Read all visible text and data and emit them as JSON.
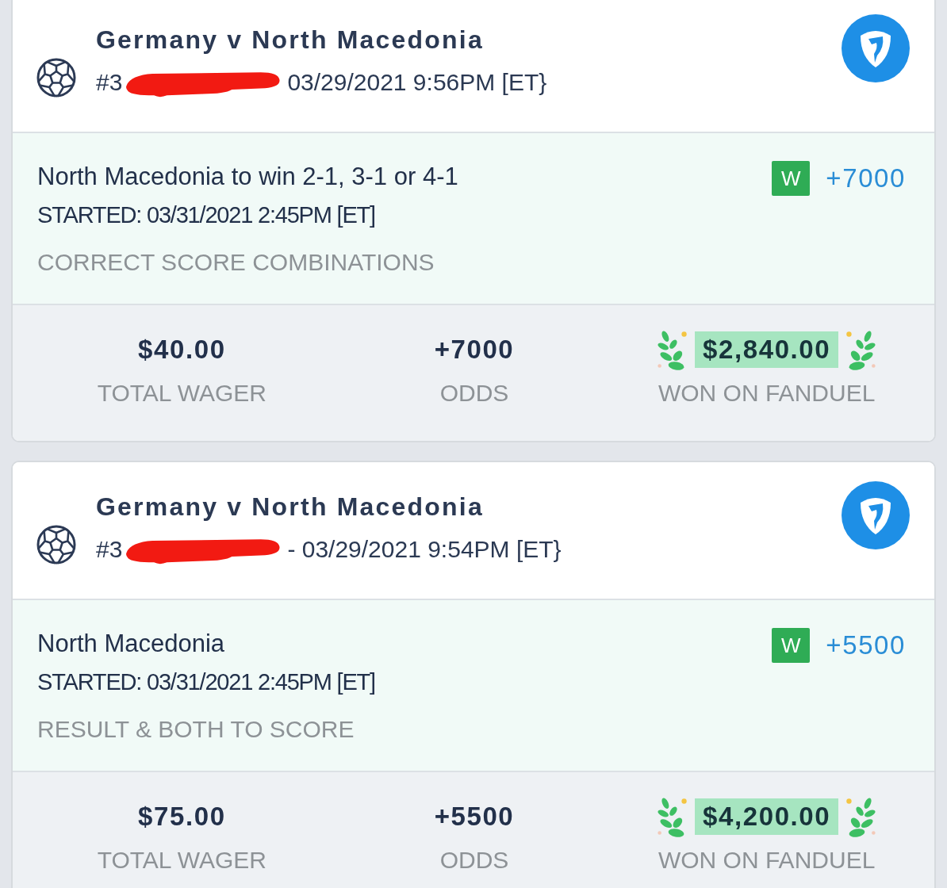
{
  "bets": [
    {
      "title": "Germany v North Macedonia",
      "bet_id": "#3",
      "redacted": true,
      "placed": "03/29/2021 9:56PM [ET}",
      "selection": "North Macedonia to win 2-1, 3-1 or 4-1",
      "started": "STARTED: 03/31/2021 2:45PM [ET]",
      "market": "CORRECT SCORE COMBINATIONS",
      "result": "W",
      "odds": "+7000",
      "stats": [
        {
          "kind": "wager",
          "value": "$40.00",
          "label": "TOTAL WAGER"
        },
        {
          "kind": "odds",
          "value": "+7000",
          "label": "ODDS"
        },
        {
          "kind": "won",
          "value": "$2,840.00",
          "label": "WON ON FANDUEL"
        }
      ]
    },
    {
      "title": "Germany v North Macedonia",
      "bet_id": "#3",
      "redacted": true,
      "placed": "- 03/29/2021 9:54PM [ET}",
      "selection": "North Macedonia",
      "started": "STARTED: 03/31/2021 2:45PM [ET]",
      "market": "RESULT & BOTH TO SCORE",
      "result": "W",
      "odds": "+5500",
      "stats": [
        {
          "kind": "wager",
          "value": "$75.00",
          "label": "TOTAL WAGER"
        },
        {
          "kind": "odds",
          "value": "+5500",
          "label": "ODDS"
        },
        {
          "kind": "won",
          "value": "$4,200.00",
          "label": "WON ON FANDUEL"
        }
      ]
    }
  ]
}
